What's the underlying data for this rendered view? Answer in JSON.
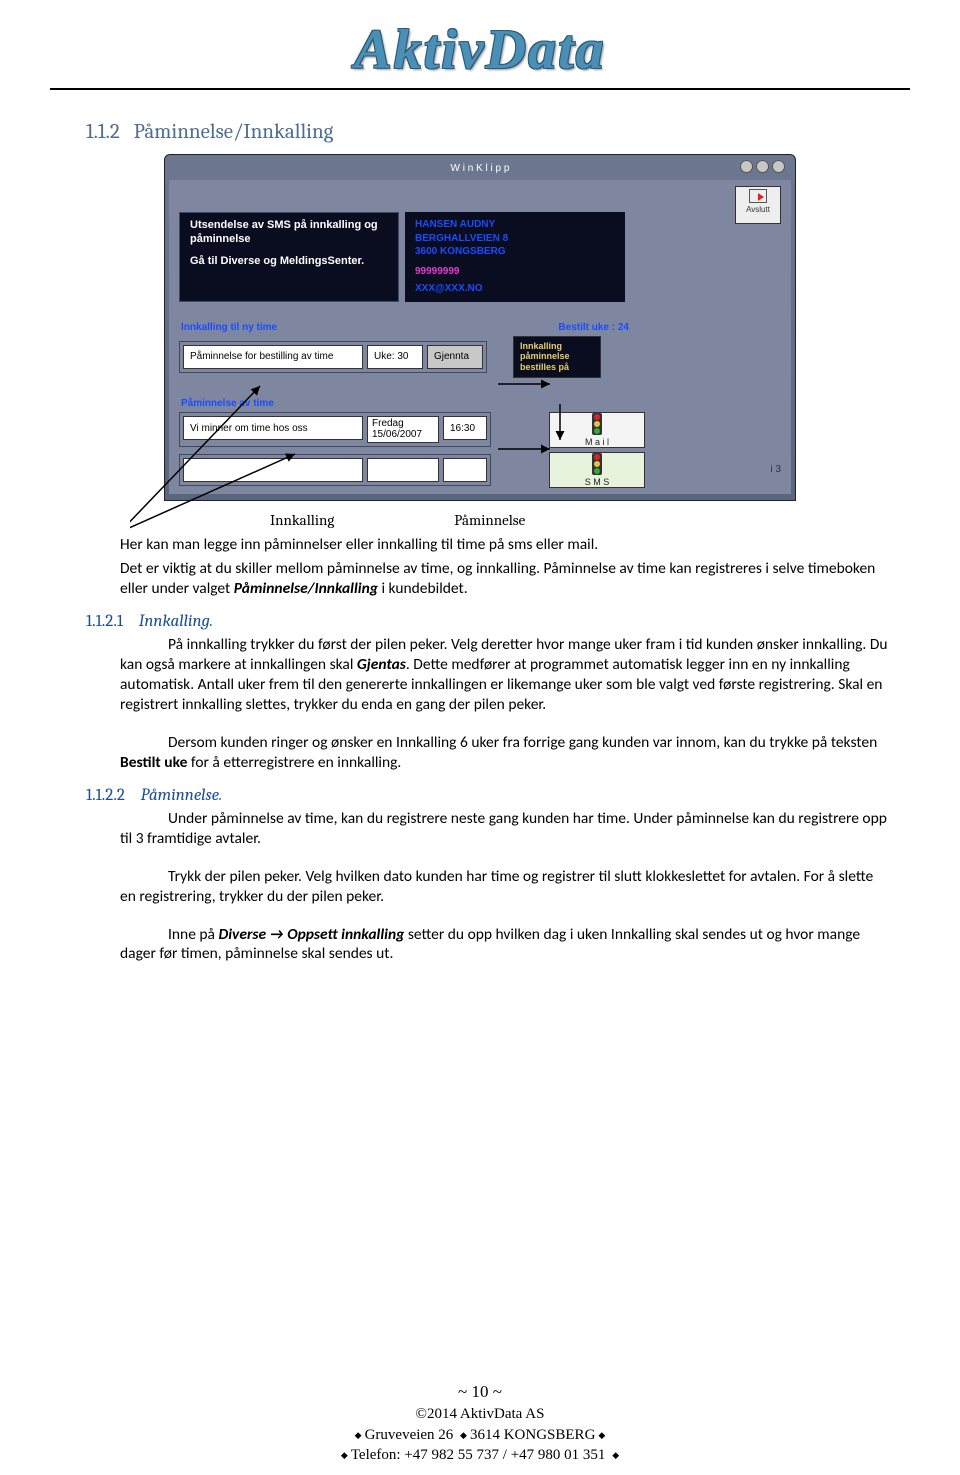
{
  "logo": "AktivData",
  "section_num": "1.1.2",
  "section_title": "Påminnelse/Innkalling",
  "screenshot": {
    "titlebar": "W i n K l i p p",
    "exit_label": "Avslutt",
    "sms_panel": {
      "l1": "Utsendelse av SMS på innkalling og påminnelse",
      "l2": "Gå til Diverse og MeldingsSenter."
    },
    "customer": {
      "name": "HANSEN AUDNY",
      "addr": "BERGHALLVEIEN 8",
      "city": "3600 KONGSBERG",
      "phone": "99999999",
      "email": "XXX@XXX.NO"
    },
    "innkalling_label": "Innkalling til ny time",
    "bestilt_label": "Bestilt uke : 24",
    "bestilling_msg": "Påminnelse for bestilling av time",
    "uke_label": "Uke: 30",
    "gjennta_label": "Gjennta",
    "bestilles_box": "Innkalling\npåminnelse\nbestilles på",
    "paminnelse_label": "Påminnelse av time",
    "reminder_msg": "Vi minner om time hos oss",
    "date_label": "Fredag\n15/06/2007",
    "time_label": "16:30",
    "mail_label": "M a i l",
    "sms_label": "S M S",
    "corner_num": "i 3"
  },
  "caption": {
    "left": "Innkalling",
    "right": "Påminnelse"
  },
  "intro_1": "Her kan man legge inn påminnelser eller innkalling til time på sms eller mail.",
  "intro_2": "Det er viktig at du skiller mellom påminnelse av time, og innkalling. Påminnelse av time kan registreres i selve timeboken eller under valget ",
  "intro_2_bi": "Påminnelse/Innkalling",
  "intro_2_tail": " i kundebildet.",
  "sub1_num": "1.1.2.1",
  "sub1_title": "Innkalling.",
  "p1a": "På innkalling trykker du først der pilen peker. Velg deretter hvor mange uker fram i tid kunden ønsker innkalling. Du kan også markere at innkallingen skal ",
  "p1a_bi": "Gjentas",
  "p1a_tail": ". Dette medfører at programmet automatisk legger inn en ny innkalling automatisk. Antall uker frem til den genererte innkallingen er likemange uker som ble valgt ved første registrering. Skal en registrert innkalling slettes, trykker du enda en gang der pilen peker.",
  "p1b": "Dersom kunden ringer og ønsker en Innkalling 6 uker fra forrige gang kunden var innom, kan du trykke på teksten ",
  "p1b_b": "Bestilt uke",
  "p1b_tail": " for å etterregistrere en innkalling.",
  "sub2_num": "1.1.2.2",
  "sub2_title": "Påminnelse.",
  "p2a": "Under påminnelse av time, kan du registrere neste gang kunden har time. Under påminnelse kan du registrere opp til 3 framtidige avtaler.",
  "p2b": "Trykk der pilen peker. Velg hvilken dato kunden har time og registrer til slutt klokkeslettet for avtalen. For å slette en registrering, trykker du der pilen peker.",
  "p2c_1": "Inne på ",
  "p2c_b1": "Diverse",
  "p2c_b2": " Oppsett innkalling",
  "p2c_2": " setter du opp hvilken dag i uken Innkalling skal sendes ut og hvor mange dager før timen, påminnelse skal sendes ut.",
  "footer": {
    "page": "~ 10 ~",
    "copy": "2014 AktivData AS",
    "addr1": "Gruveveien 26",
    "addr2": "3614  KONGSBERG",
    "tel_lbl": "Telefon:",
    "tel1": "+47 982 55 737",
    "tel2": "+47 980 01 351"
  }
}
